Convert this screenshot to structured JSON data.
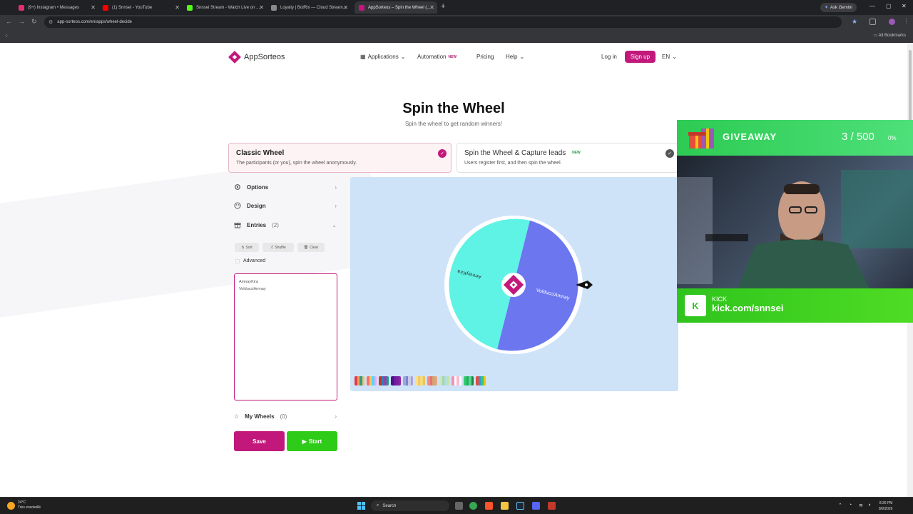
{
  "browser": {
    "tabs": [
      {
        "label": "(9+) Instagram • Messages",
        "color": "#e1306c"
      },
      {
        "label": "(1) Snnsei - YouTube",
        "color": "#ff0000"
      },
      {
        "label": "Snnsei Stream - Watch Live on ...",
        "color": "#53fc18"
      },
      {
        "label": "Loyalty | BotRix — Cloud Stream...",
        "color": "#8a8a8a"
      },
      {
        "label": "AppSorteos – Spin the Wheel (...",
        "color": "#c2187b"
      }
    ],
    "active_tab": 4,
    "new_tab_symbol": "+",
    "ask_gemini": "Ask Gemini",
    "url": "app-sorteos.com/en/apps/wheel-decide",
    "all_bookmarks": "All Bookmarks"
  },
  "site": {
    "brand": "AppSorteos",
    "brand_color": "#c2187b",
    "nav": {
      "applications": "Applications",
      "automation": "Automation",
      "automation_badge": "NEW",
      "pricing": "Pricing",
      "help": "Help",
      "login": "Log in",
      "signup": "Sign up",
      "language": "EN"
    },
    "title": "Spin the Wheel",
    "subtitle": "Spin the wheel to get random winners!",
    "cards": [
      {
        "title": "Classic Wheel",
        "desc": "The participants (or you), spin the wheel anonymously.",
        "selected": true
      },
      {
        "title": "Spin the Wheel & Capture leads",
        "badge": "NEW",
        "desc": "Users register first, and then spin the wheel.",
        "selected": false
      }
    ],
    "panel": {
      "options": "Options",
      "design": "Design",
      "entries": "Entries",
      "entries_count": "(2)",
      "sort": "Sort",
      "shuffle": "Shuffle",
      "clear": "Clear",
      "advanced": "Advanced",
      "entries_text": "AmnayKira\nVolducciAmnay",
      "my_wheels": "My Wheels",
      "my_wheels_count": "(0)",
      "save": "Save",
      "start": "Start"
    },
    "wheel": {
      "segments": [
        {
          "label": "AmnayKira",
          "color": "#5ef3e4"
        },
        {
          "label": "VolducciAmnay",
          "color": "#6b76ef"
        }
      ]
    },
    "palette": [
      [
        "#e63946",
        "#f4a261",
        "#2a9d8f",
        "#e9c46a"
      ],
      [
        "#ff6b6b",
        "#feca57",
        "#48dbfb",
        "#ff9ff3"
      ],
      [
        "#c0392b",
        "#2980b9",
        "#8e44ad",
        "#16a085"
      ],
      [
        "#4a148c",
        "#6a1b9a",
        "#7b1fa2",
        "#8e24aa"
      ],
      [
        "#9fa8da",
        "#7986cb",
        "#c5cae9",
        "#b39ddb"
      ],
      [
        "#f8e187",
        "#f3c969",
        "#f5d97a",
        "#eec55b"
      ],
      [
        "#f28b82",
        "#e57373",
        "#d4a373",
        "#e6a57e"
      ],
      [
        "#c8e6c9",
        "#a5d6a7",
        "#b2dfdb",
        "#c5e1a5"
      ],
      [
        "#f48fb1",
        "#ffffff",
        "#f8bbd0",
        "#ffffff"
      ],
      [
        "#2ecc71",
        "#27ae60",
        "#58d68d",
        "#1e8449"
      ],
      [
        "#e74c3c",
        "#3498db",
        "#2ecc71",
        "#f1c40f"
      ]
    ]
  },
  "stream_overlay": {
    "giveaway_label": "GIVEAWAY",
    "count": "3 / 500",
    "percent": "0%",
    "kick_label": "KICK",
    "kick_url": "kick.com/snnsei"
  },
  "taskbar": {
    "temperature": "24°C",
    "weather_desc": "Très ensoleillé",
    "search": "Search",
    "time": "8:26 PM",
    "date": "8/9/2026"
  }
}
